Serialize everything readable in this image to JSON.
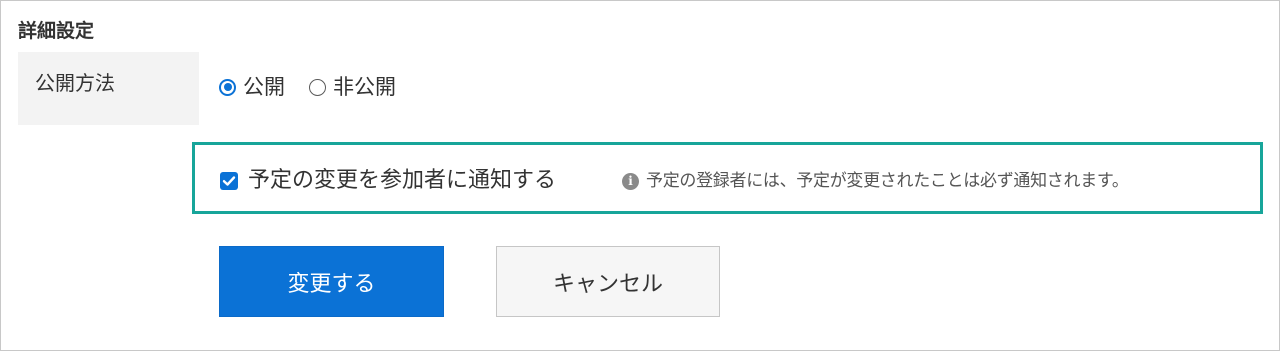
{
  "section": {
    "title": "詳細設定"
  },
  "visibility": {
    "label": "公開方法",
    "options": [
      {
        "label": "公開",
        "selected": true
      },
      {
        "label": "非公開",
        "selected": false
      }
    ]
  },
  "notify": {
    "checkbox_label": "予定の変更を参加者に通知する",
    "checked": true,
    "note": "予定の登録者には、予定が変更されたことは必ず通知されます。",
    "highlight_color": "#17a59a"
  },
  "actions": {
    "submit_label": "変更する",
    "cancel_label": "キャンセル",
    "primary_color": "#0b72d6"
  },
  "icons": {
    "info": "i"
  }
}
